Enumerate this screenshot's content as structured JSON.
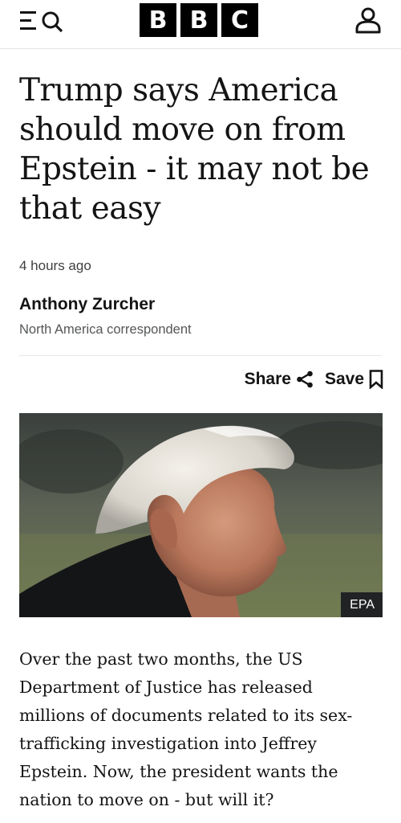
{
  "header": {
    "logo_letters": [
      "B",
      "B",
      "C"
    ],
    "icons": {
      "menu": "menu-icon",
      "search": "search-icon",
      "account": "account-icon"
    }
  },
  "article": {
    "headline": "Trump says America should move on from Epstein - it may not be that easy",
    "timestamp": "4 hours ago",
    "author_name": "Anthony Zurcher",
    "author_role": "North America correspondent",
    "share_label": "Share",
    "save_label": "Save",
    "image_credit": "EPA",
    "body_first_paragraph": "Over the past two months, the US Department of Justice has released millions of documents related to its sex-trafficking investigation into Jeffrey Epstein. Now, the president wants the nation to move on - but will it?"
  }
}
